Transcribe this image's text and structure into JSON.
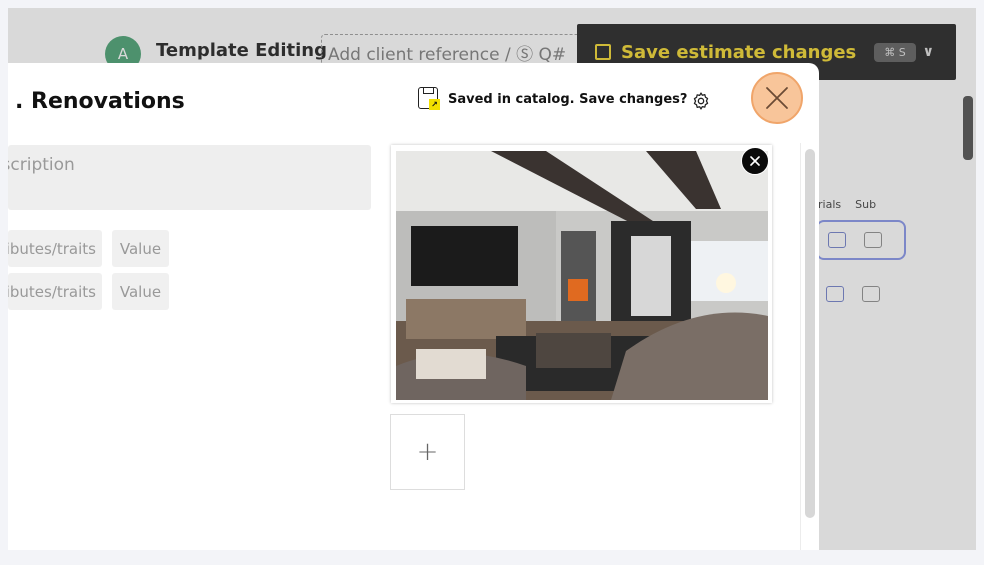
{
  "background": {
    "avatar_letter": "A",
    "title": "Template Editing",
    "client_ref_placeholder": "Add client reference / Ⓢ Q#",
    "save_button_label": "Save estimate changes",
    "save_shortcut": "⌘ S",
    "column_labels": [
      "rials",
      "Sub"
    ]
  },
  "modal": {
    "title": ". Renovations",
    "saved_status": "Saved in catalog. Save changes?",
    "description_placeholder": "Description",
    "attributes": [
      {
        "name_placeholder": "Attributes/traits",
        "value_placeholder": "Value"
      },
      {
        "name_placeholder": "Attributes/traits",
        "value_placeholder": "Value"
      }
    ],
    "add_image_label": "+"
  },
  "colors": {
    "accent_yellow": "#f2d520",
    "close_highlight": "#f8c59a",
    "avatar_green": "#3e9c6a"
  },
  "icons": [
    "save-doc-icon",
    "gear-icon",
    "close-icon",
    "remove-image-icon",
    "plus-icon"
  ]
}
